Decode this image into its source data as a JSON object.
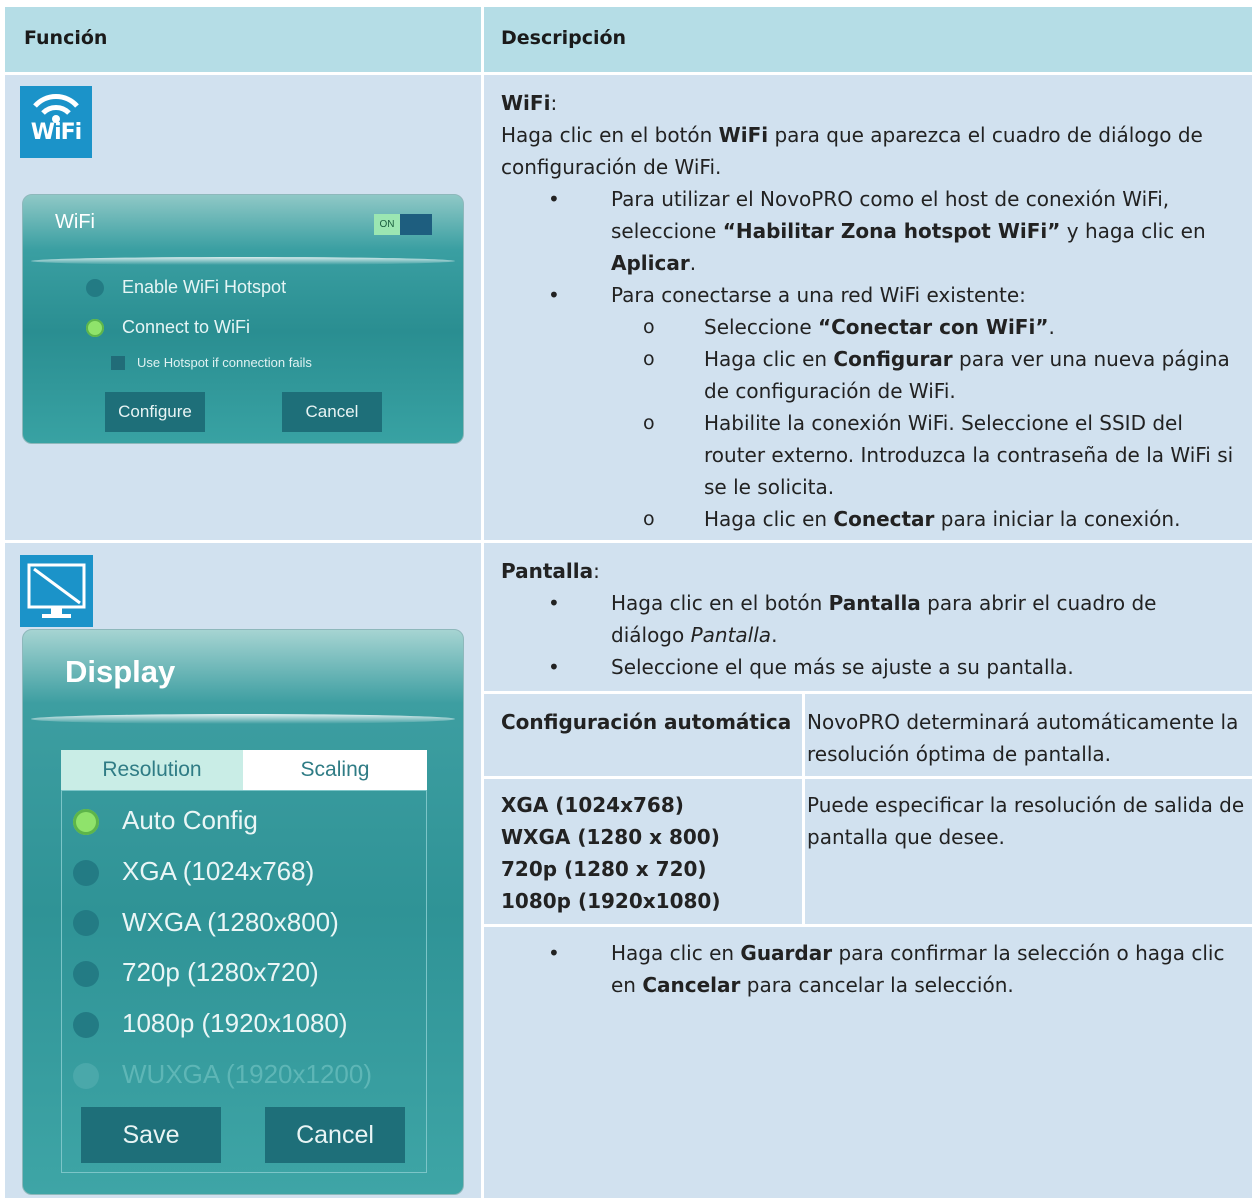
{
  "header": {
    "col1": "Función",
    "col2": "Descripción"
  },
  "wifi": {
    "icon_label": "WiFi",
    "dialog": {
      "title": "WiFi",
      "toggle": "ON",
      "opt1": "Enable WiFi Hotspot",
      "opt2": "Connect to WiFi",
      "check": "Use Hotspot if connection fails",
      "btn_configure": "Configure",
      "btn_cancel": "Cancel"
    },
    "title": "WiFi",
    "title_suffix": ":",
    "intro": {
      "a": "Haga clic en el botón ",
      "b": "WiFi",
      "c": " para que aparezca el cuadro de diálogo de configuración de WiFi."
    },
    "bullet1": {
      "a": "Para utilizar el NovoPRO como el host de conexión WiFi, seleccione ",
      "b": "“Habilitar Zona hotspot WiFi”",
      "c": " y haga clic en ",
      "d": "Aplicar",
      "e": "."
    },
    "bullet2": "Para conectarse a una red WiFi existente:",
    "sub1": {
      "a": "Seleccione ",
      "b": "“Conectar con WiFi”",
      "c": "."
    },
    "sub2": {
      "a": "Haga clic en ",
      "b": "Configurar",
      "c": " para ver una nueva página de configuración de WiFi."
    },
    "sub3": "Habilite la conexión WiFi. Seleccione el SSID del router externo. Introduzca la contraseña de la WiFi si se le solicita.",
    "sub4": {
      "a": "Haga clic en ",
      "b": "Conectar",
      "c": " para iniciar la conexión."
    }
  },
  "display": {
    "dialog": {
      "title": "Display",
      "tab1": "Resolution",
      "tab2": "Scaling",
      "options": [
        "Auto Config",
        "XGA (1024x768)",
        "WXGA (1280x800)",
        "720p (1280x720)",
        "1080p (1920x1080)",
        "WUXGA (1920x1200)"
      ],
      "btn_save": "Save",
      "btn_cancel": "Cancel"
    },
    "title": "Pantalla",
    "title_suffix": ":",
    "bullet1": {
      "a": "Haga clic en el botón ",
      "b": "Pantalla",
      "c": " para abrir el cuadro de diálogo ",
      "d": "Pantalla",
      "e": "."
    },
    "bullet2": "Seleccione el que más se ajuste a su pantalla.",
    "table": {
      "r1_label": "Configuración automática",
      "r1_desc": "NovoPRO determinará automáticamente la resolución óptima de pantalla.",
      "r2_labels": [
        "XGA (1024x768)",
        "WXGA (1280 x 800)",
        "720p (1280 x 720)",
        "1080p (1920x1080)"
      ],
      "r2_desc": "Puede especificar la resolución de salida de pantalla que desee."
    },
    "bullet3": {
      "a": "Haga clic en ",
      "b": "Guardar",
      "c": " para confirmar la selección o haga clic en ",
      "d": "Cancelar",
      "e": " para cancelar la selección."
    }
  }
}
